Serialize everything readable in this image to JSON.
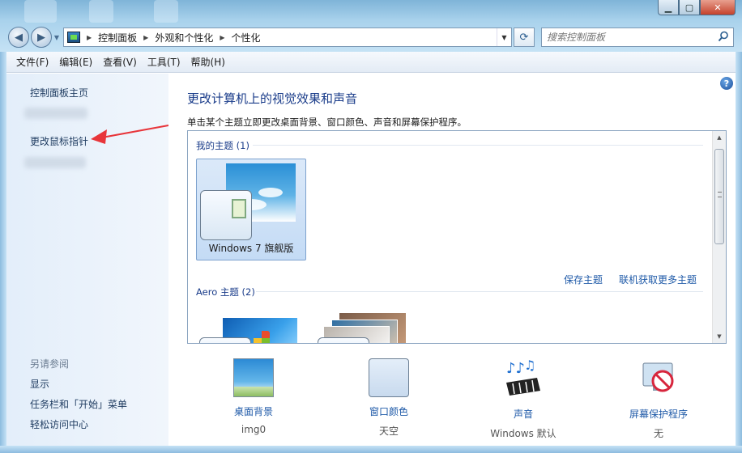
{
  "address": {
    "crumbs": [
      "控制面板",
      "外观和个性化",
      "个性化"
    ]
  },
  "search": {
    "placeholder": "搜索控制面板"
  },
  "menu": [
    "文件(F)",
    "编辑(E)",
    "查看(V)",
    "工具(T)",
    "帮助(H)"
  ],
  "sidebar": {
    "home": "控制面板主页",
    "change_mouse": "更改鼠标指针",
    "see_also": "另请参阅",
    "links": [
      "显示",
      "任务栏和「开始」菜单",
      "轻松访问中心"
    ]
  },
  "main": {
    "title": "更改计算机上的视觉效果和声音",
    "subtitle": "单击某个主题立即更改桌面背景、窗口颜色、声音和屏幕保护程序。",
    "my_themes": "我的主题 (1)",
    "theme_name": "Windows 7 旗舰版",
    "save_theme": "保存主题",
    "more_themes": "联机获取更多主题",
    "aero_themes": "Aero 主题 (2)"
  },
  "bottom": [
    {
      "label": "桌面背景",
      "value": "img0",
      "icon": "desktop-background-icon"
    },
    {
      "label": "窗口颜色",
      "value": "天空",
      "icon": "window-color-icon"
    },
    {
      "label": "声音",
      "value": "Windows 默认",
      "icon": "sound-icon"
    },
    {
      "label": "屏幕保护程序",
      "value": "无",
      "icon": "screensaver-icon"
    }
  ],
  "colors": {
    "link": "#1f5aa8",
    "title": "#1a3c8a",
    "annotation": "#e8353a"
  }
}
